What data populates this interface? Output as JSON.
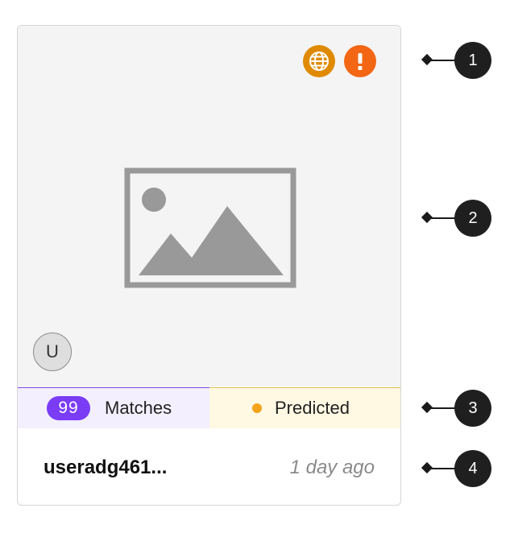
{
  "card": {
    "avatar_initial": "U",
    "icons": {
      "globe": "globe-icon",
      "alert": "alert-icon",
      "image_placeholder": "image-placeholder-icon"
    },
    "matches": {
      "count": "99",
      "label": "Matches"
    },
    "status": {
      "label": "Predicted"
    },
    "footer": {
      "username": "useradg461...",
      "timestamp": "1 day ago"
    }
  },
  "callouts": [
    "1",
    "2",
    "3",
    "4"
  ],
  "colors": {
    "globe_badge": "#df8a00",
    "alert_badge": "#f36614",
    "matches_pill": "#7a3cf5",
    "matches_bg": "#f4efff",
    "predicted_bg": "#fff8e3",
    "predicted_dot": "#f3a31c"
  }
}
